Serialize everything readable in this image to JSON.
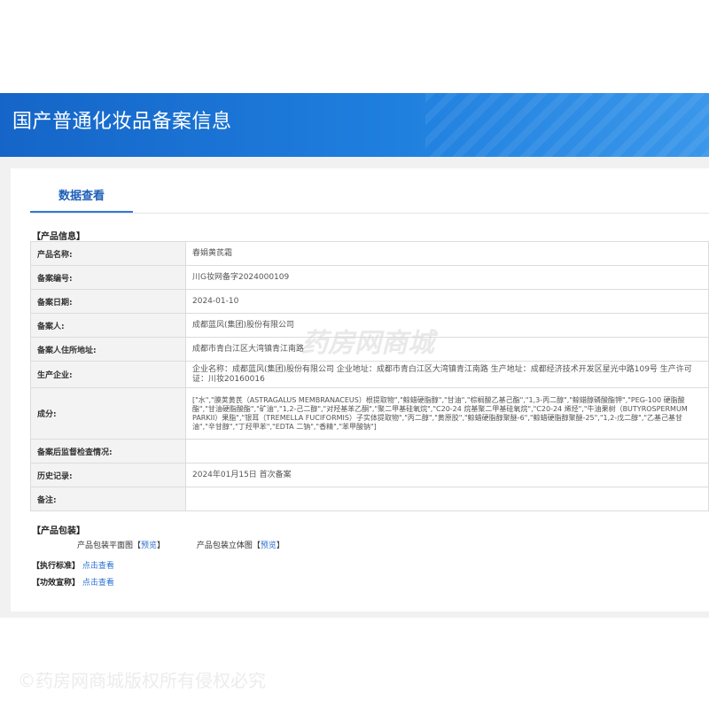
{
  "banner": {
    "title": "国产普通化妆品备案信息"
  },
  "tabs": [
    {
      "label": "数据查看"
    }
  ],
  "product_info": {
    "section_title": "【产品信息】",
    "rows": [
      {
        "label": "产品名称:",
        "value": "春娟黄芪霜"
      },
      {
        "label": "备案编号:",
        "value": "川G妆网备字2024000109"
      },
      {
        "label": "备案日期:",
        "value": "2024-01-10"
      },
      {
        "label": "备案人:",
        "value": "成都蓝风(集团)股份有限公司"
      },
      {
        "label": "备案人住所地址:",
        "value": "成都市青白江区大湾镇青江南路"
      },
      {
        "label": "生产企业:",
        "value": "企业名称：成都蓝风(集团)股份有限公司 企业地址：成都市青白江区大湾镇青江南路 生产地址：成都经济技术开发区星光中路109号 生产许可证：川妆20160016"
      },
      {
        "label": "成分:",
        "value": "[\"水\",\"膜荚黄芪（ASTRAGALUS MEMBRANACEUS）根提取物\",\"鲸蜡硬脂醇\",\"甘油\",\"棕榈酸乙基己酯\",\"1,3-丙二醇\",\"鲸蜡醇磷酸酯钾\",\"PEG-100 硬脂酸酯\",\"甘油硬脂酸酯\",\"矿油\",\"1,2-己二醇\",\"对羟基苯乙酮\",\"聚二甲基硅氧烷\",\"C20-24 烷基聚二甲基硅氧烷\",\"C20-24 烯烃\",\"牛油果树（BUTYROSPERMUM PARKII）果脂\",\"银耳（TREMELLA FUCIFORMIS）子实体提取物\",\"丙二醇\",\"黄原胶\",\"鲸蜡硬脂醇聚醚-6\",\"鲸蜡硬脂醇聚醚-25\",\"1,2-戊二醇\",\"乙基己基甘油\",\"辛甘醇\",\"丁羟甲苯\",\"EDTA 二钠\",\"香精\",\"苯甲酸钠\"]"
      },
      {
        "label": "备案后监督检查情况:",
        "value": ""
      },
      {
        "label": "历史记录:",
        "value": "2024年01月15日 首次备案"
      },
      {
        "label": "备注:",
        "value": ""
      }
    ]
  },
  "packaging": {
    "section_title": "【产品包装】",
    "flat_label": "产品包装平面图",
    "flat_link": "预览",
    "solid_label": "产品包装立体图",
    "solid_link": "预览"
  },
  "standard": {
    "label": "【执行标准】",
    "link": "点击查看"
  },
  "efficacy": {
    "label": "【功效宣称】",
    "link": "点击查看"
  },
  "watermark": "药房网商城",
  "copyright": "©药房网商城版权所有侵权必究"
}
